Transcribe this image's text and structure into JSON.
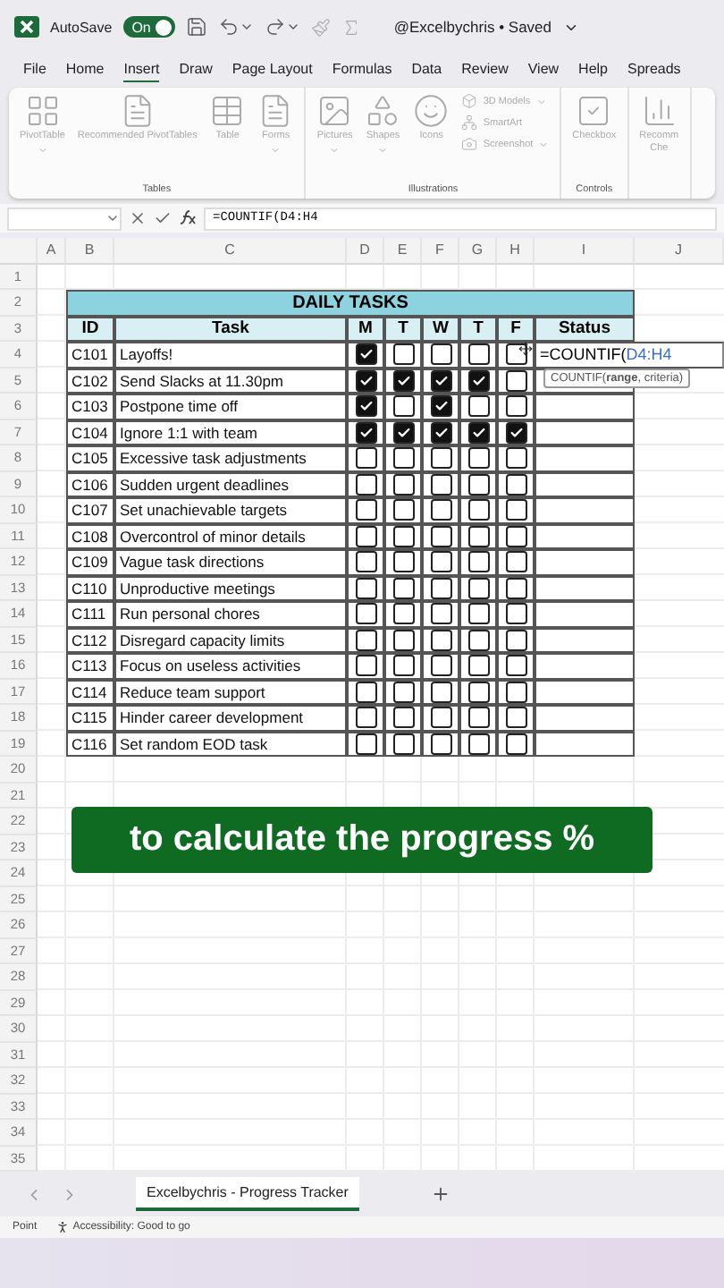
{
  "titlebar": {
    "autosave_label": "AutoSave",
    "autosave_toggle": {
      "label": "On",
      "on": true
    },
    "document": "@Excelbychris • Saved"
  },
  "menu_tabs": [
    {
      "label": "File",
      "selected": false
    },
    {
      "label": "Home",
      "selected": false
    },
    {
      "label": "Insert",
      "selected": true
    },
    {
      "label": "Draw",
      "selected": false
    },
    {
      "label": "Page Layout",
      "selected": false
    },
    {
      "label": "Formulas",
      "selected": false
    },
    {
      "label": "Data",
      "selected": false
    },
    {
      "label": "Review",
      "selected": false
    },
    {
      "label": "View",
      "selected": false
    },
    {
      "label": "Help",
      "selected": false
    },
    {
      "label": "Spreads",
      "selected": false
    }
  ],
  "ribbon": {
    "disabled": true,
    "groups": [
      {
        "label": "Tables",
        "items": [
          {
            "kind": "large",
            "label": "PivotTable",
            "dropdown": true
          },
          {
            "kind": "large",
            "label": "Recommended PivotTables",
            "dropdown": false
          },
          {
            "kind": "large",
            "label": "Table",
            "dropdown": false
          },
          {
            "kind": "large",
            "label": "Forms",
            "dropdown": true
          }
        ]
      },
      {
        "label": "Illustrations",
        "items": [
          {
            "kind": "large",
            "label": "Pictures",
            "dropdown": true
          },
          {
            "kind": "large",
            "label": "Shapes",
            "dropdown": true
          },
          {
            "kind": "large",
            "label": "Icons",
            "dropdown": false
          },
          {
            "kind": "small",
            "label": "3D Models",
            "dropdown": true
          },
          {
            "kind": "small",
            "label": "SmartArt",
            "dropdown": false
          },
          {
            "kind": "small",
            "label": "Screenshot",
            "dropdown": true
          }
        ]
      },
      {
        "label": "Controls",
        "items": [
          {
            "kind": "large",
            "label": "Checkbox",
            "dropdown": false
          }
        ]
      },
      {
        "items": [
          {
            "kind": "large",
            "label": "Recomm\nChe",
            "dropdown": false
          }
        ]
      }
    ]
  },
  "formula_bar": {
    "formula": "=COUNTIF(D4:H4"
  },
  "column_headers": [
    "A",
    "B",
    "C",
    "D",
    "E",
    "F",
    "G",
    "H",
    "I",
    "J"
  ],
  "row_headers": [
    "1",
    "2",
    "3",
    "4",
    "5",
    "6",
    "7",
    "8",
    "9",
    "10",
    "11",
    "12",
    "13",
    "14",
    "15",
    "16",
    "17",
    "18",
    "19",
    "20",
    "21",
    "22",
    "23",
    "24",
    "25",
    "26",
    "27",
    "28",
    "29",
    "30",
    "31",
    "32",
    "33",
    "34",
    "35"
  ],
  "table": {
    "title": "DAILY TASKS",
    "columns": [
      "ID",
      "Task",
      "M",
      "T",
      "W",
      "T",
      "F",
      "Status"
    ],
    "rows": [
      {
        "id": "C101",
        "task": "Layoffs!",
        "days": [
          {
            "checked": true
          },
          {
            "checked": false
          },
          {
            "checked": false
          },
          {
            "checked": false
          },
          {
            "checked": false
          }
        ],
        "editing": {
          "formula_prefix": "=COUNTIF(",
          "formula_ref": "D4:H4",
          "tooltip": "COUNTIF(**range**, criteria)"
        }
      },
      {
        "id": "C102",
        "task": "Send Slacks at 11.30pm",
        "days": [
          {
            "checked": true
          },
          {
            "checked": true
          },
          {
            "checked": true
          },
          {
            "checked": true
          },
          {
            "checked": false
          }
        ]
      },
      {
        "id": "C103",
        "task": "Postpone time off",
        "days": [
          {
            "checked": true
          },
          {
            "checked": false
          },
          {
            "checked": true
          },
          {
            "checked": false
          },
          {
            "checked": false
          }
        ]
      },
      {
        "id": "C104",
        "task": "Ignore 1:1 with team",
        "days": [
          {
            "checked": true
          },
          {
            "checked": true
          },
          {
            "checked": true
          },
          {
            "checked": true
          },
          {
            "checked": true
          }
        ]
      },
      {
        "id": "C105",
        "task": "Excessive task adjustments",
        "days": [
          {
            "checked": false
          },
          {
            "checked": false
          },
          {
            "checked": false
          },
          {
            "checked": false
          },
          {
            "checked": false
          }
        ]
      },
      {
        "id": "C106",
        "task": "Sudden urgent deadlines",
        "days": [
          {
            "checked": false
          },
          {
            "checked": false
          },
          {
            "checked": false
          },
          {
            "checked": false
          },
          {
            "checked": false
          }
        ]
      },
      {
        "id": "C107",
        "task": "Set unachievable targets",
        "days": [
          {
            "checked": false
          },
          {
            "checked": false
          },
          {
            "checked": false
          },
          {
            "checked": false
          },
          {
            "checked": false
          }
        ]
      },
      {
        "id": "C108",
        "task": "Overcontrol of minor details",
        "days": [
          {
            "checked": false
          },
          {
            "checked": false
          },
          {
            "checked": false
          },
          {
            "checked": false
          },
          {
            "checked": false
          }
        ]
      },
      {
        "id": "C109",
        "task": "Vague task directions",
        "days": [
          {
            "checked": false
          },
          {
            "checked": false
          },
          {
            "checked": false
          },
          {
            "checked": false
          },
          {
            "checked": false
          }
        ]
      },
      {
        "id": "C110",
        "task": "Unproductive meetings",
        "days": [
          {
            "checked": false
          },
          {
            "checked": false
          },
          {
            "checked": false
          },
          {
            "checked": false
          },
          {
            "checked": false
          }
        ]
      },
      {
        "id": "C111",
        "task": "Run personal chores",
        "days": [
          {
            "checked": false
          },
          {
            "checked": false
          },
          {
            "checked": false
          },
          {
            "checked": false
          },
          {
            "checked": false
          }
        ]
      },
      {
        "id": "C112",
        "task": "Disregard capacity limits",
        "days": [
          {
            "checked": false
          },
          {
            "checked": false
          },
          {
            "checked": false
          },
          {
            "checked": false
          },
          {
            "checked": false
          }
        ]
      },
      {
        "id": "C113",
        "task": "Focus on useless activities",
        "days": [
          {
            "checked": false
          },
          {
            "checked": false
          },
          {
            "checked": false
          },
          {
            "checked": false
          },
          {
            "checked": false
          }
        ]
      },
      {
        "id": "C114",
        "task": "Reduce team support",
        "days": [
          {
            "checked": false
          },
          {
            "checked": false
          },
          {
            "checked": false
          },
          {
            "checked": false
          },
          {
            "checked": false
          }
        ]
      },
      {
        "id": "C115",
        "task": "Hinder career development",
        "days": [
          {
            "checked": false
          },
          {
            "checked": false
          },
          {
            "checked": false
          },
          {
            "checked": false
          },
          {
            "checked": false
          }
        ]
      },
      {
        "id": "C116",
        "task": "Set random EOD task",
        "days": [
          {
            "checked": false
          },
          {
            "checked": false
          },
          {
            "checked": false
          },
          {
            "checked": false
          },
          {
            "checked": false
          }
        ]
      }
    ]
  },
  "caption": "to calculate the progress %",
  "sheet_tabs": [
    {
      "label": "Excelbychris - Progress Tracker",
      "selected": true
    }
  ],
  "status_bar": {
    "mode": "Point",
    "accessibility": "Accessibility: Good to go"
  }
}
